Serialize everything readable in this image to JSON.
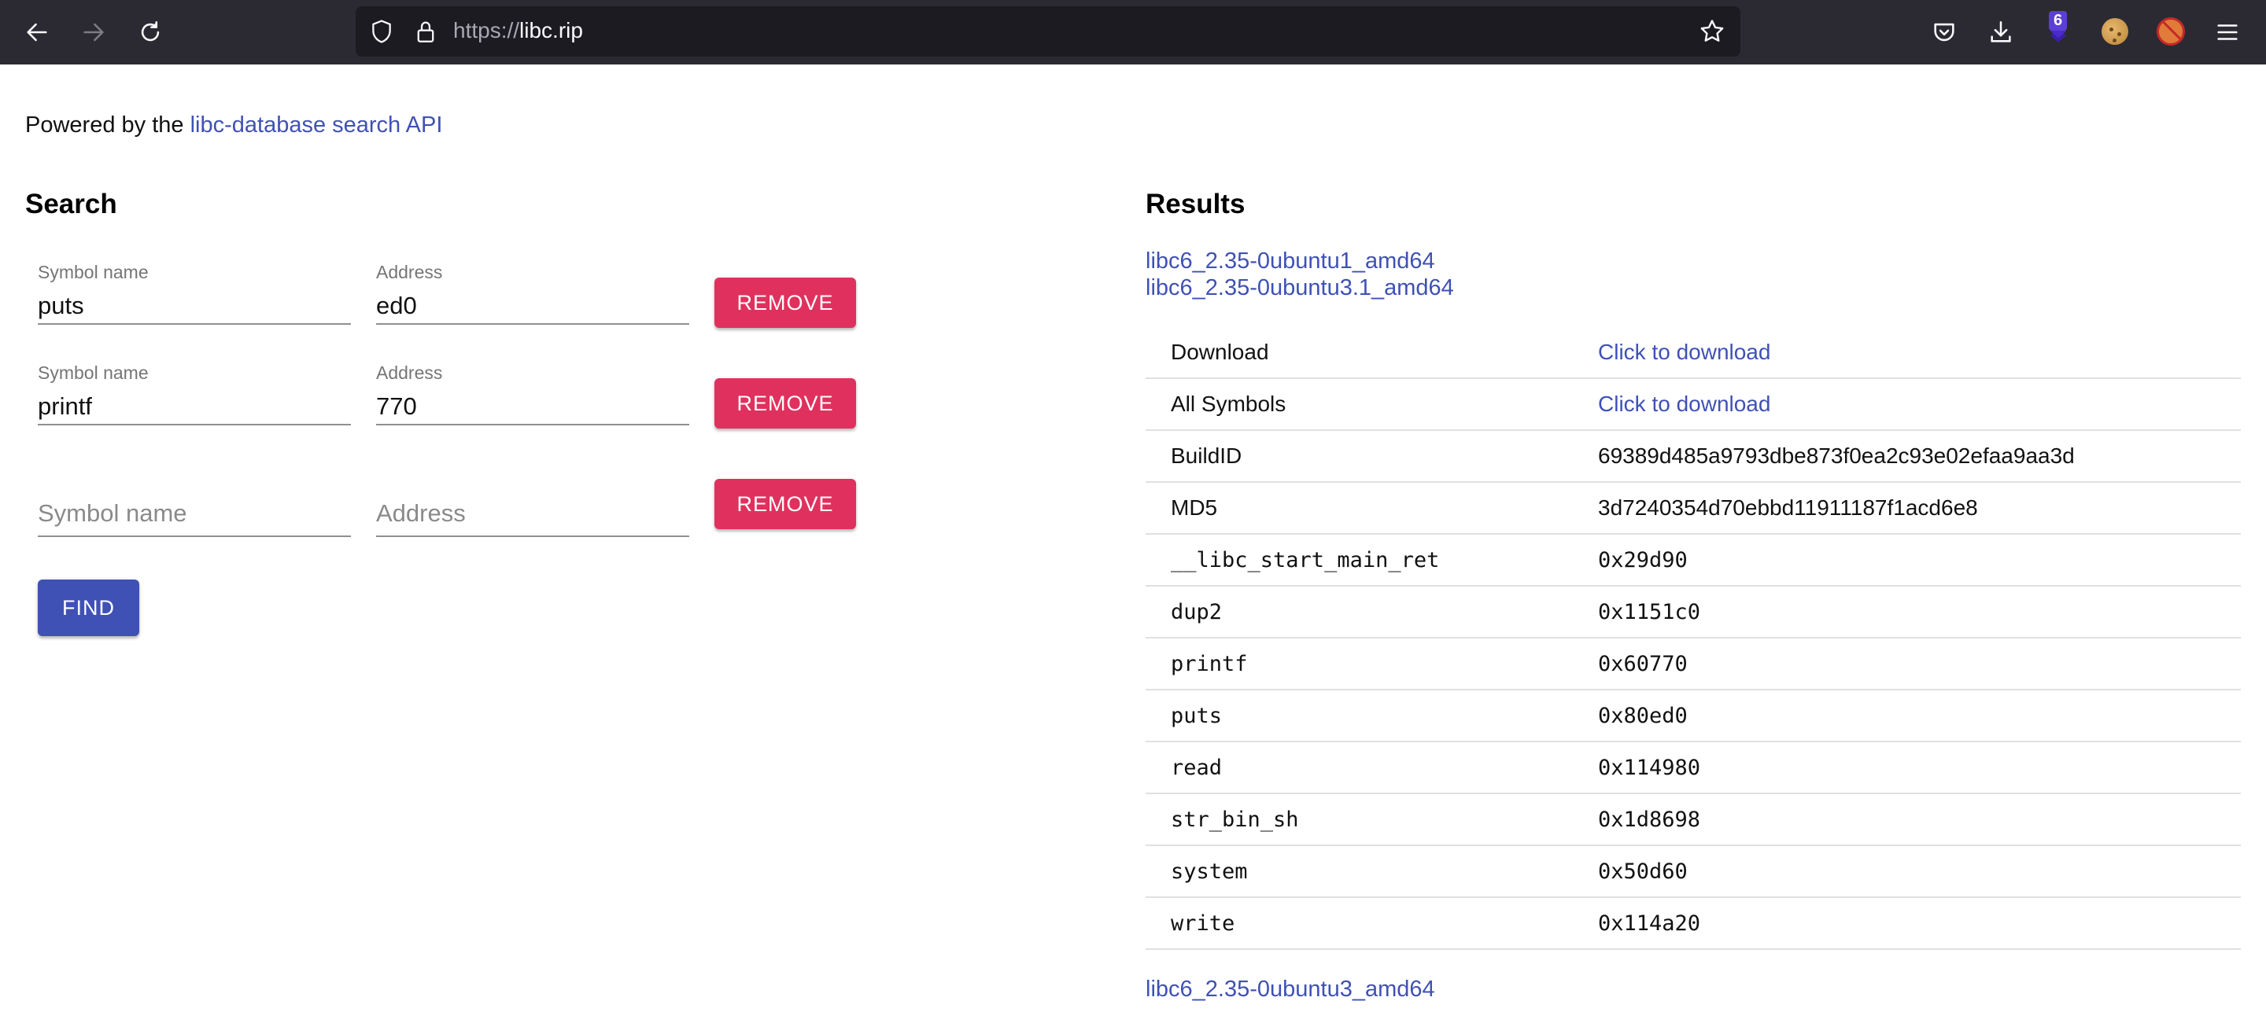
{
  "browser": {
    "url_scheme": "https://",
    "url_host": "libc.rip",
    "extension_badge_count": "6",
    "icons": [
      "back-icon",
      "forward-icon",
      "reload-icon",
      "shield-icon",
      "lock-icon",
      "bookmark-star-icon",
      "pocket-icon",
      "download-icon",
      "extension-icon",
      "cookie-icon",
      "no-ads-icon",
      "menu-icon"
    ]
  },
  "header": {
    "powered_prefix": "Powered by the ",
    "powered_link": "libc-database search API"
  },
  "search": {
    "title": "Search",
    "rows": [
      {
        "symbol_label": "Symbol name",
        "symbol_value": "puts",
        "address_label": "Address",
        "address_value": "ed0",
        "remove_label": "Remove"
      },
      {
        "symbol_label": "Symbol name",
        "symbol_value": "printf",
        "address_label": "Address",
        "address_value": "770",
        "remove_label": "Remove"
      },
      {
        "symbol_placeholder": "Symbol name",
        "address_placeholder": "Address",
        "remove_label": "Remove"
      }
    ],
    "find_label": "Find"
  },
  "results": {
    "title": "Results",
    "libs": [
      "libc6_2.35-0ubuntu1_amd64",
      "libc6_2.35-0ubuntu3.1_amd64",
      "libc6_2.35-0ubuntu3_amd64"
    ],
    "table": [
      {
        "key": "Download",
        "value": "Click to download",
        "is_link": true
      },
      {
        "key": "All Symbols",
        "value": "Click to download",
        "is_link": true
      },
      {
        "key": "BuildID",
        "value": "69389d485a9793dbe873f0ea2c93e02efaa9aa3d"
      },
      {
        "key": "MD5",
        "value": "3d7240354d70ebbd11911187f1acd6e8"
      },
      {
        "key": "__libc_start_main_ret",
        "value": "0x29d90",
        "mono": true
      },
      {
        "key": "dup2",
        "value": "0x1151c0",
        "mono": true
      },
      {
        "key": "printf",
        "value": "0x60770",
        "mono": true
      },
      {
        "key": "puts",
        "value": "0x80ed0",
        "mono": true
      },
      {
        "key": "read",
        "value": "0x114980",
        "mono": true
      },
      {
        "key": "str_bin_sh",
        "value": "0x1d8698",
        "mono": true
      },
      {
        "key": "system",
        "value": "0x50d60",
        "mono": true
      },
      {
        "key": "write",
        "value": "0x114a20",
        "mono": true
      }
    ]
  },
  "colors": {
    "toolbar_bg": "#2b2a33",
    "link": "#3f51b5",
    "remove_button": "#e0315e",
    "find_button": "#4051b5"
  }
}
